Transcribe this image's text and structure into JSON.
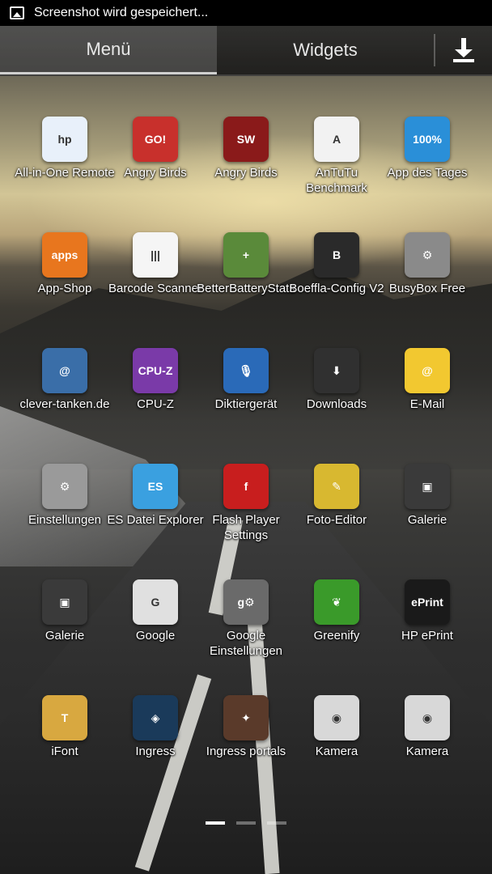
{
  "status_bar": {
    "notification_text": "Screenshot wird gespeichert..."
  },
  "tabs": {
    "menu": "Menü",
    "widgets": "Widgets"
  },
  "apps": [
    {
      "label": "All-in-One Remote",
      "icon": "hp-remote-icon",
      "color": "#e8f0fa",
      "glyph": "hp"
    },
    {
      "label": "Angry Birds",
      "icon": "angry-birds-go-icon",
      "color": "#c8302c",
      "glyph": "GO!"
    },
    {
      "label": "Angry Birds",
      "icon": "angry-birds-star-wars-icon",
      "color": "#8a1a1a",
      "glyph": "SW"
    },
    {
      "label": "AnTuTu Benchmark",
      "icon": "antutu-icon",
      "color": "#f2f2f2",
      "glyph": "A"
    },
    {
      "label": "App des Tages",
      "icon": "app-des-tages-icon",
      "color": "#2a8fd8",
      "glyph": "100%"
    },
    {
      "label": "App-Shop",
      "icon": "amazon-appstore-icon",
      "color": "#e8761e",
      "glyph": "apps"
    },
    {
      "label": "Barcode Scanner",
      "icon": "barcode-scanner-icon",
      "color": "#f5f5f5",
      "glyph": "|||"
    },
    {
      "label": "BetterBatteryStats",
      "icon": "battery-icon",
      "color": "#5a8a3a",
      "glyph": "+"
    },
    {
      "label": "Boeffla-Config V2",
      "icon": "boeffla-icon",
      "color": "#2a2a2a",
      "glyph": "B"
    },
    {
      "label": "BusyBox Free",
      "icon": "busybox-icon",
      "color": "#8a8a8a",
      "glyph": "⚙"
    },
    {
      "label": "clever-tanken.de",
      "icon": "clever-tanken-icon",
      "color": "#3a6ea8",
      "glyph": "@"
    },
    {
      "label": "CPU-Z",
      "icon": "cpu-z-icon",
      "color": "#7a3aa8",
      "glyph": "CPU-Z"
    },
    {
      "label": "Diktiergerät",
      "icon": "microphone-icon",
      "color": "#2a6ab8",
      "glyph": "🎙"
    },
    {
      "label": "Downloads",
      "icon": "downloads-icon",
      "color": "#303030",
      "glyph": "⬇"
    },
    {
      "label": "E-Mail",
      "icon": "email-icon",
      "color": "#f2c830",
      "glyph": "@"
    },
    {
      "label": "Einstellungen",
      "icon": "settings-gear-icon",
      "color": "#9a9a9a",
      "glyph": "⚙"
    },
    {
      "label": "ES Datei Explorer",
      "icon": "es-file-explorer-icon",
      "color": "#3aa0e0",
      "glyph": "ES"
    },
    {
      "label": "Flash Player Settings",
      "icon": "flash-player-icon",
      "color": "#c81e1e",
      "glyph": "f"
    },
    {
      "label": "Foto-Editor",
      "icon": "photo-editor-icon",
      "color": "#d8b830",
      "glyph": "✎"
    },
    {
      "label": "Galerie",
      "icon": "gallery-icon",
      "color": "#3a3a3a",
      "glyph": "▣"
    },
    {
      "label": "Galerie",
      "icon": "gallery-icon",
      "color": "#3a3a3a",
      "glyph": "▣"
    },
    {
      "label": "Google",
      "icon": "google-chrome-icon",
      "color": "#e0e0e0",
      "glyph": "G"
    },
    {
      "label": "Google Einstellungen",
      "icon": "google-settings-icon",
      "color": "#6a6a6a",
      "glyph": "g⚙"
    },
    {
      "label": "Greenify",
      "icon": "greenify-leaf-icon",
      "color": "#3a9a2a",
      "glyph": "❦"
    },
    {
      "label": "HP ePrint",
      "icon": "hp-eprint-icon",
      "color": "#1a1a1a",
      "glyph": "ePrint"
    },
    {
      "label": "iFont",
      "icon": "ifont-icon",
      "color": "#d8a840",
      "glyph": "T"
    },
    {
      "label": "Ingress",
      "icon": "ingress-icon",
      "color": "#1a3a5a",
      "glyph": "◈"
    },
    {
      "label": "Ingress portals",
      "icon": "ingress-portals-icon",
      "color": "#5a3a2a",
      "glyph": "✦"
    },
    {
      "label": "Kamera",
      "icon": "camera-icon",
      "color": "#d8d8d8",
      "glyph": "◉"
    },
    {
      "label": "Kamera",
      "icon": "camera-icon",
      "color": "#d8d8d8",
      "glyph": "◉"
    }
  ],
  "pager": {
    "pages": 3,
    "current": 1
  }
}
